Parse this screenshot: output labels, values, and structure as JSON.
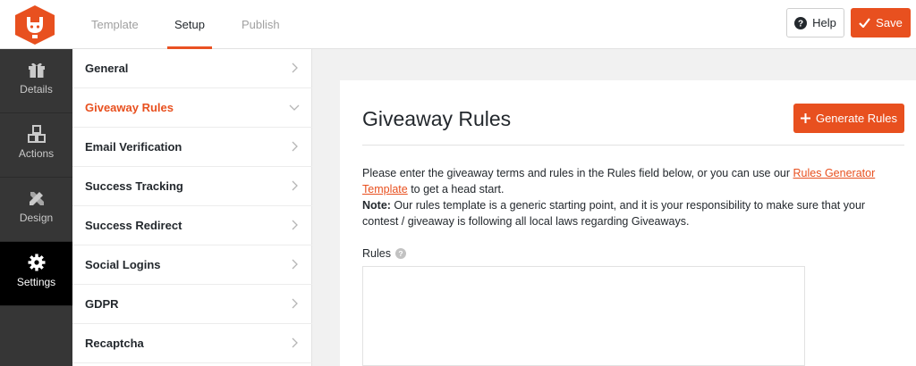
{
  "header": {
    "tabs": [
      {
        "label": "Template"
      },
      {
        "label": "Setup"
      },
      {
        "label": "Publish"
      }
    ],
    "help_label": "Help",
    "save_label": "Save",
    "accent_color": "#e8501f"
  },
  "leftnav": {
    "items": [
      {
        "label": "Details",
        "icon": "gift-icon"
      },
      {
        "label": "Actions",
        "icon": "boxes-icon"
      },
      {
        "label": "Design",
        "icon": "design-tools-icon"
      },
      {
        "label": "Settings",
        "icon": "gear-icon"
      }
    ]
  },
  "settings": {
    "items": [
      {
        "label": "General"
      },
      {
        "label": "Giveaway Rules"
      },
      {
        "label": "Email Verification"
      },
      {
        "label": "Success Tracking"
      },
      {
        "label": "Success Redirect"
      },
      {
        "label": "Social Logins"
      },
      {
        "label": "GDPR"
      },
      {
        "label": "Recaptcha"
      }
    ]
  },
  "main": {
    "title": "Giveaway Rules",
    "generate_label": "Generate Rules",
    "desc_part1": "Please enter the giveaway terms and rules in the Rules field below, or you can use our ",
    "desc_link": "Rules Generator Template",
    "desc_part2": " to get a head start.",
    "note_label": "Note:",
    "note_text": " Our rules template is a generic starting point, and it is your responsibility to make sure that your contest / giveaway is following all local laws regarding Giveaways.",
    "rules_label": "Rules"
  }
}
